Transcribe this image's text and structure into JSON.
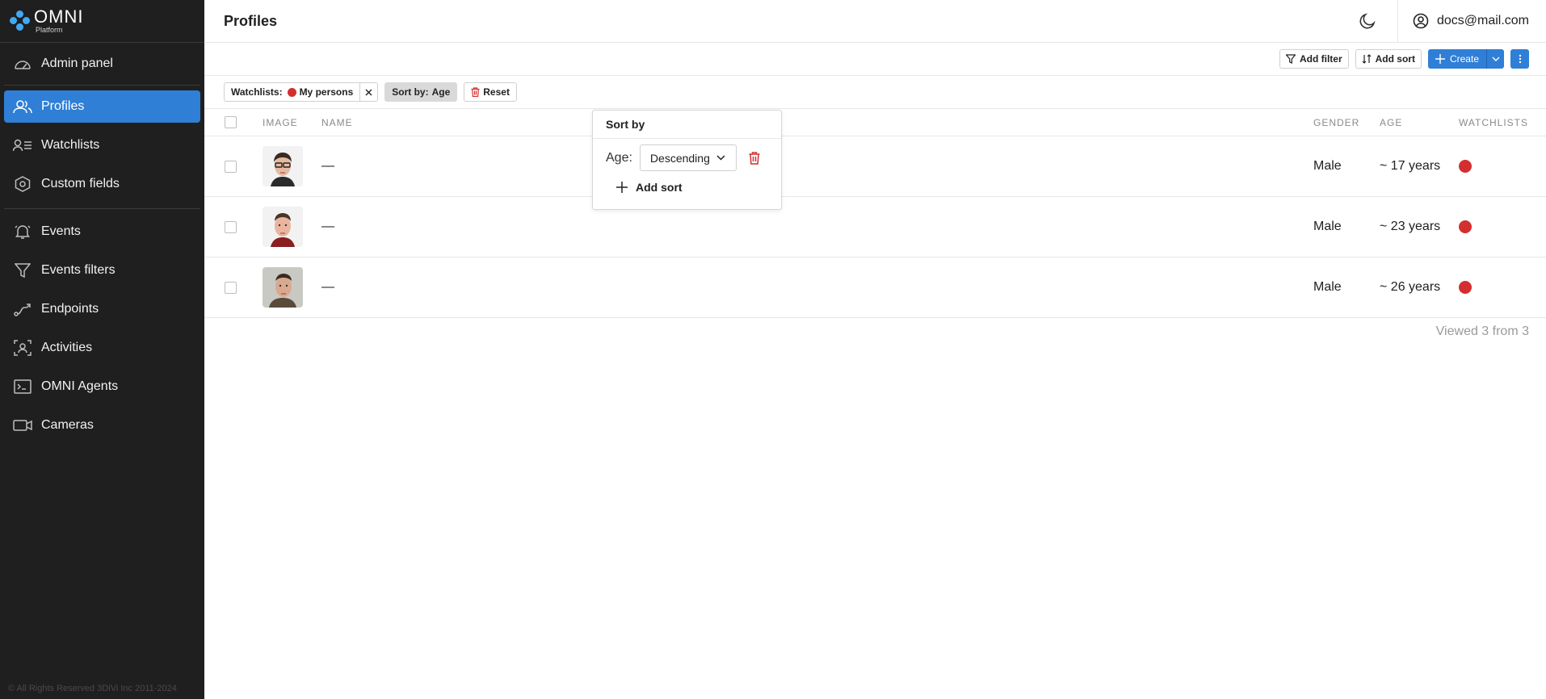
{
  "sidebar": {
    "logo": {
      "name": "OMNI",
      "sub": "Platform"
    },
    "items": [
      {
        "label": "Admin panel",
        "icon": "gauge-icon"
      },
      {
        "label": "Profiles",
        "icon": "users-icon",
        "active": true
      },
      {
        "label": "Watchlists",
        "icon": "user-list-icon"
      },
      {
        "label": "Custom fields",
        "icon": "hexagon-icon"
      },
      {
        "label": "Events",
        "icon": "bell-icon"
      },
      {
        "label": "Events filters",
        "icon": "funnel-icon"
      },
      {
        "label": "Endpoints",
        "icon": "route-icon"
      },
      {
        "label": "Activities",
        "icon": "person-scan-icon"
      },
      {
        "label": "OMNI Agents",
        "icon": "terminal-icon"
      },
      {
        "label": "Cameras",
        "icon": "camera-icon"
      }
    ],
    "copyright": "© All Rights Reserved 3DiVi Inc 2011-2024"
  },
  "header": {
    "title": "Profiles",
    "user_email": "docs@mail.com"
  },
  "toolbar": {
    "add_filter": "Add filter",
    "add_sort": "Add sort",
    "create": "Create"
  },
  "chips": {
    "watchlists_key": "Watchlists:",
    "watchlists_value": "My persons",
    "sort_key": "Sort by:",
    "sort_value": "Age",
    "reset": "Reset"
  },
  "table": {
    "columns": [
      "IMAGE",
      "NAME",
      "GENDER",
      "AGE",
      "WATCHLISTS"
    ],
    "rows": [
      {
        "name": "—",
        "gender": "Male",
        "age": "~ 17 years"
      },
      {
        "name": "—",
        "gender": "Male",
        "age": "~ 23 years"
      },
      {
        "name": "—",
        "gender": "Male",
        "age": "~ 26 years"
      }
    ],
    "viewed": "Viewed 3 from 3"
  },
  "sort_popover": {
    "title": "Sort by",
    "field_label": "Age:",
    "direction": "Descending",
    "add_sort": "Add sort"
  },
  "colors": {
    "accent": "#2f7fd6",
    "sidebar_bg": "#1f1f1f",
    "watchlist_dot": "#d32f2f"
  }
}
